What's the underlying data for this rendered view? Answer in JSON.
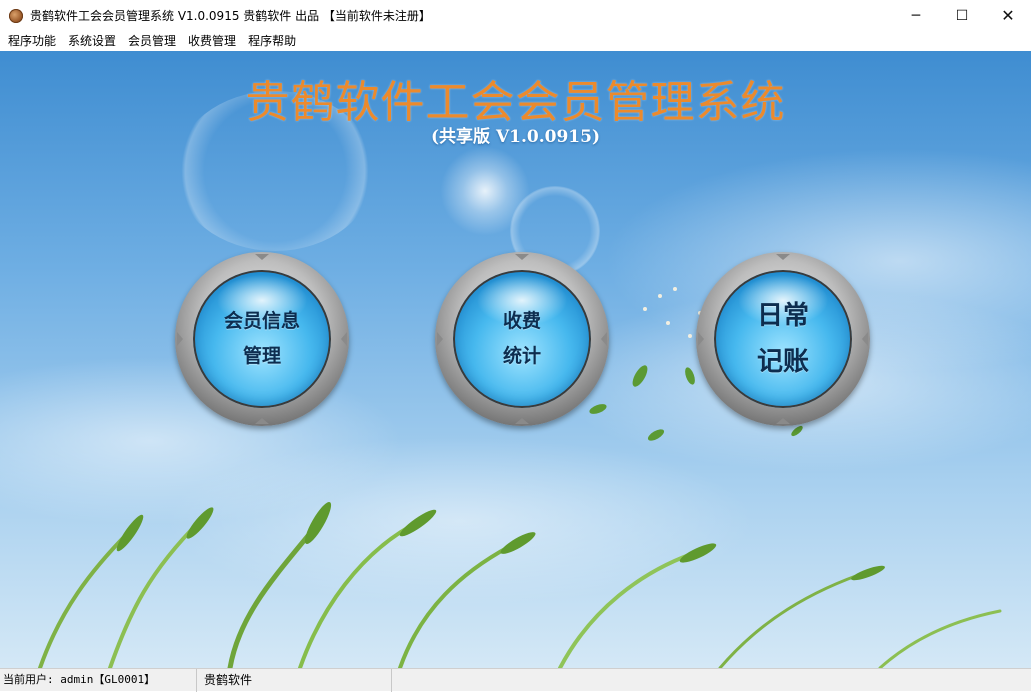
{
  "window": {
    "title": "贵鹤软件工会会员管理系统 V1.0.0915 贵鹤软件 出品 【当前软件未注册】",
    "icon": "app-logo-icon",
    "controls": {
      "minimize": "─",
      "maximize": "☐",
      "close": "✕"
    }
  },
  "menu": {
    "items": [
      {
        "label": "程序功能"
      },
      {
        "label": "系统设置"
      },
      {
        "label": "会员管理"
      },
      {
        "label": "收费管理"
      },
      {
        "label": "程序帮助"
      }
    ]
  },
  "main": {
    "title": "贵鹤软件工会会员管理系统",
    "version": "(共享版 V1.0.0915)",
    "buttons": [
      {
        "line1": "会员信息",
        "line2": "管理"
      },
      {
        "line1": "收费",
        "line2": "统计"
      },
      {
        "line1": "日常",
        "line2": "记账"
      }
    ]
  },
  "status": {
    "user": "当前用户: admin【GL0001】",
    "company": "贵鹤软件"
  },
  "colors": {
    "title_orange": "#ec8a2c",
    "button_blue": "#46b8ee",
    "sky_blue": "#6eaee3"
  }
}
